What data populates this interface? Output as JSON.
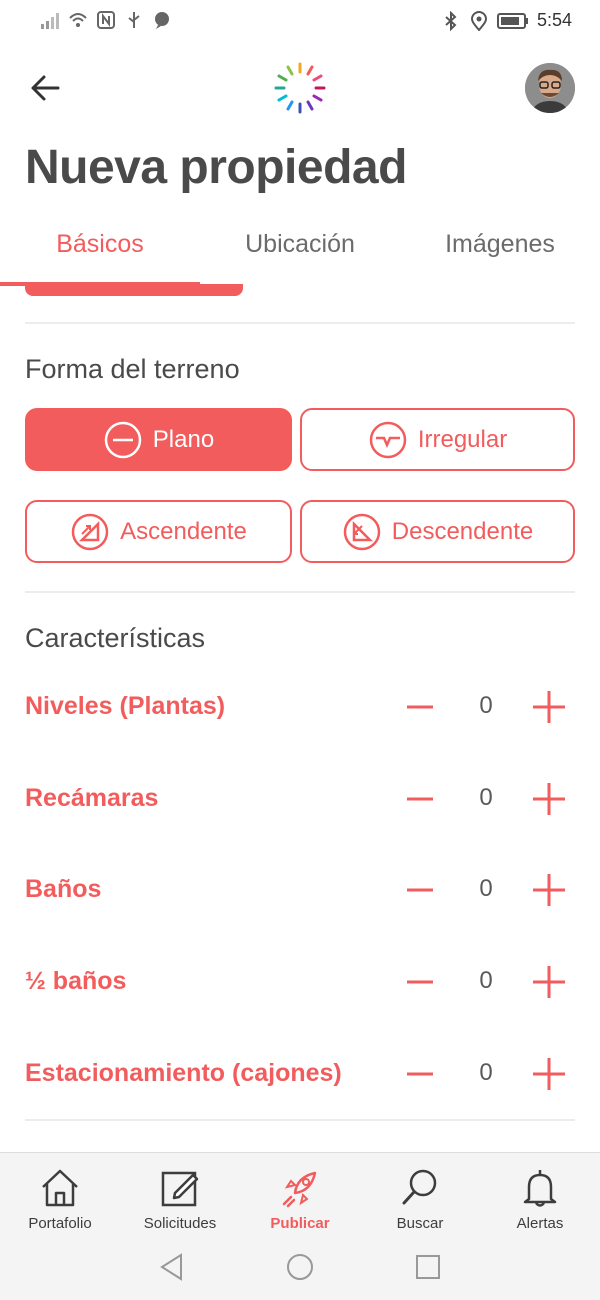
{
  "status_bar": {
    "time": "5:54"
  },
  "header": {
    "back_icon": "arrow-left-icon",
    "logo": "sunburst-logo",
    "avatar": "user-avatar"
  },
  "page_title": "Nueva propiedad",
  "tabs": [
    {
      "label": "Básicos",
      "active": true
    },
    {
      "label": "Ubicación",
      "active": false
    },
    {
      "label": "Imágenes",
      "active": false
    }
  ],
  "terrain": {
    "title": "Forma del terreno",
    "options": [
      {
        "label": "Plano",
        "icon": "flat-icon",
        "selected": true
      },
      {
        "label": "Irregular",
        "icon": "irregular-icon",
        "selected": false
      },
      {
        "label": "Ascendente",
        "icon": "ascending-icon",
        "selected": false
      },
      {
        "label": "Descendente",
        "icon": "descending-icon",
        "selected": false
      }
    ]
  },
  "features": {
    "title": "Características",
    "rows": [
      {
        "label": "Niveles (Plantas)",
        "value": "0"
      },
      {
        "label": "Recámaras",
        "value": "0"
      },
      {
        "label": "Baños",
        "value": "0"
      },
      {
        "label": "½ baños",
        "value": "0"
      },
      {
        "label": "Estacionamiento (cajones)",
        "value": "0"
      }
    ]
  },
  "bottom_nav": [
    {
      "label": "Portafolio",
      "icon": "house-icon",
      "active": false
    },
    {
      "label": "Solicitudes",
      "icon": "edit-icon",
      "active": false
    },
    {
      "label": "Publicar",
      "icon": "rocket-icon",
      "active": true
    },
    {
      "label": "Buscar",
      "icon": "search-icon",
      "active": false
    },
    {
      "label": "Alertas",
      "icon": "bell-icon",
      "active": false
    }
  ],
  "colors": {
    "accent": "#f25c5c",
    "text": "#4a4a4a",
    "divider": "#ececec",
    "nav_bg": "#f4f4f4"
  }
}
